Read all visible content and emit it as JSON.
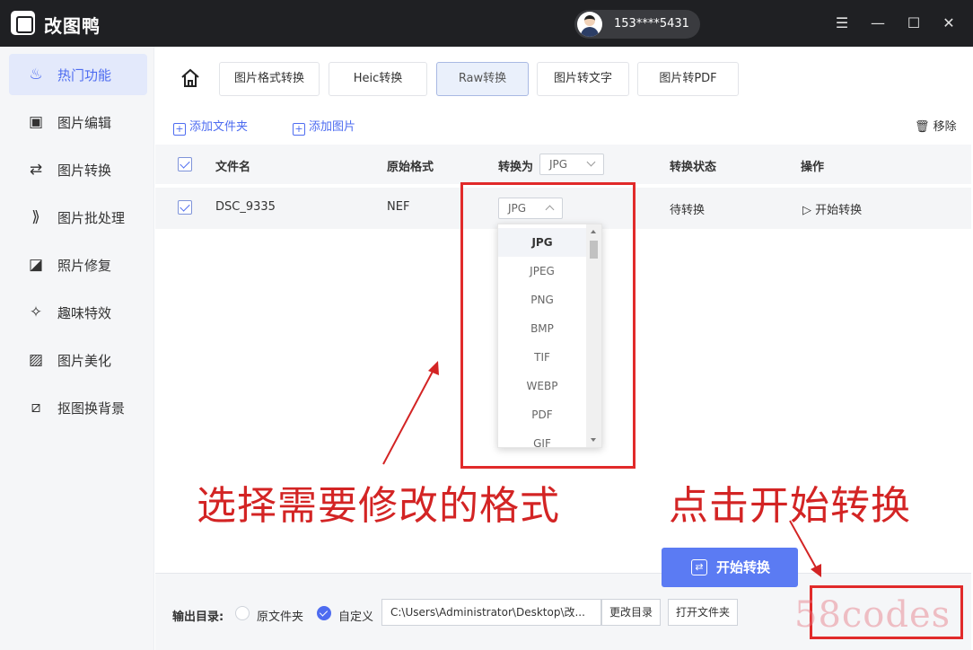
{
  "app": {
    "title": "改图鸭",
    "user": "153****5431"
  },
  "sidebar": {
    "items": [
      {
        "label": "热门功能",
        "icon": "flame-icon",
        "active": true
      },
      {
        "label": "图片编辑",
        "icon": "image-edit-icon"
      },
      {
        "label": "图片转换",
        "icon": "convert-icon"
      },
      {
        "label": "图片批处理",
        "icon": "batch-icon"
      },
      {
        "label": "照片修复",
        "icon": "photo-repair-icon"
      },
      {
        "label": "趣味特效",
        "icon": "magic-wand-icon"
      },
      {
        "label": "图片美化",
        "icon": "beautify-icon"
      },
      {
        "label": "抠图换背景",
        "icon": "cutout-icon"
      }
    ]
  },
  "tabs": [
    {
      "label": "图片格式转换"
    },
    {
      "label": "Heic转换"
    },
    {
      "label": "Raw转换",
      "active": true
    },
    {
      "label": "图片转文字"
    },
    {
      "label": "图片转PDF"
    }
  ],
  "toolbar": {
    "add_folder": "添加文件夹",
    "add_image": "添加图片",
    "remove": "移除"
  },
  "table": {
    "headers": {
      "filename": "文件名",
      "original_format": "原始格式",
      "convert_to": "转换为",
      "status": "转换状态",
      "action": "操作"
    },
    "header_select": "JPG",
    "rows": [
      {
        "filename": "DSC_9335",
        "format": "NEF",
        "target": "JPG",
        "status": "待转换",
        "action": "开始转换"
      }
    ]
  },
  "dropdown": {
    "options": [
      "JPG",
      "JPEG",
      "PNG",
      "BMP",
      "TIF",
      "WEBP",
      "PDF",
      "GIF"
    ],
    "selected": "JPG"
  },
  "footer": {
    "output_label": "输出目录:",
    "radio_original": "原文件夹",
    "radio_custom": "自定义",
    "path": "C:\\Users\\Administrator\\Desktop\\改...",
    "change_dir": "更改目录",
    "open_folder": "打开文件夹",
    "start": "开始转换"
  },
  "annotations": {
    "select_format": "选择需要修改的格式",
    "click_start": "点击开始转换",
    "watermark": "58codes"
  },
  "colors": {
    "accent": "#4e6cf0",
    "annotation_red": "#e12a2a",
    "titlebar": "#1f2023"
  }
}
